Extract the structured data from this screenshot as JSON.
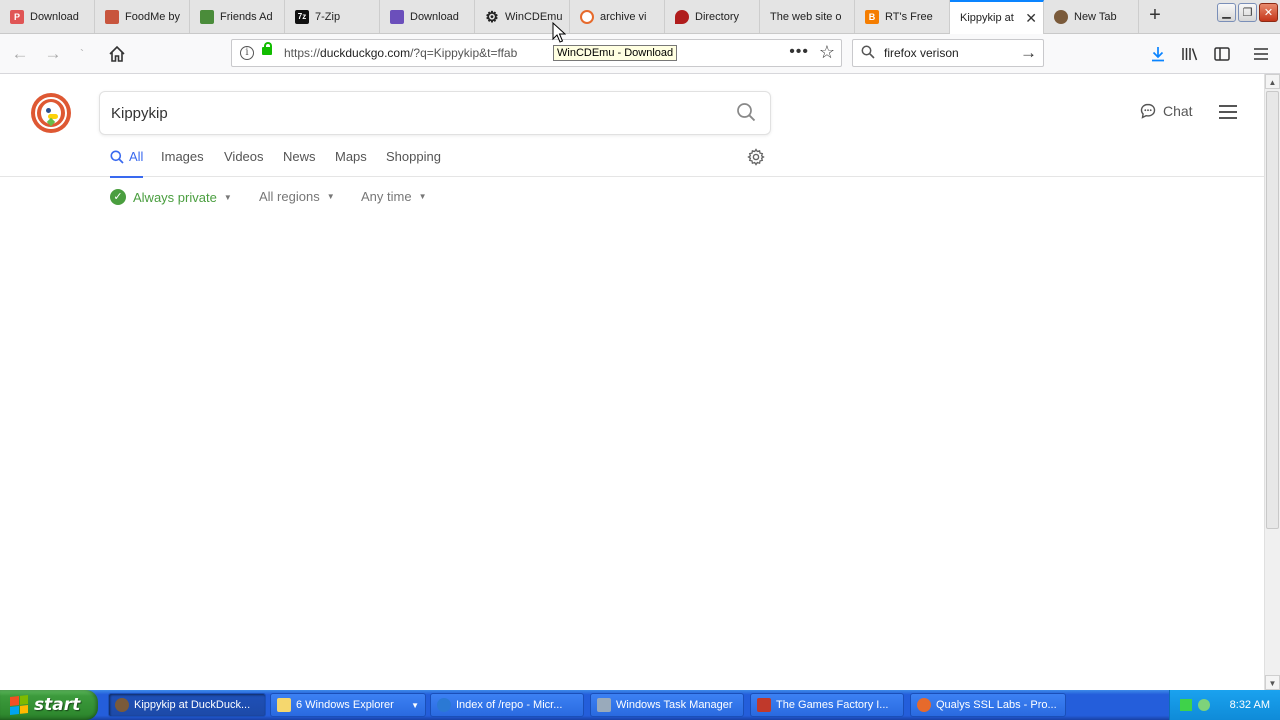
{
  "browser": {
    "tabs": [
      {
        "label": "Download",
        "icon": "pdf-icon",
        "color": "#e05555"
      },
      {
        "label": "FoodMe by",
        "icon": "food-icon",
        "color": "#c8553d"
      },
      {
        "label": "Friends Ad",
        "icon": "friends-icon",
        "color": "#4a8c3a"
      },
      {
        "label": "7-Zip",
        "icon": "7zip-icon",
        "color": "#111111"
      },
      {
        "label": "Download",
        "icon": "download-site-icon",
        "color": "#6b4fbb"
      },
      {
        "label": "WinCDEmu",
        "icon": "gear-icon",
        "color": "#222222"
      },
      {
        "label": "archive vi",
        "icon": "archive-icon",
        "color": "#e66a2c"
      },
      {
        "label": "Directory",
        "icon": "directory-icon",
        "color": "#b01c1c"
      },
      {
        "label": "The web site o",
        "icon": "",
        "color": ""
      },
      {
        "label": "RT's Free",
        "icon": "blogger-icon",
        "color": "#f57d00"
      },
      {
        "label": "Kippykip at",
        "icon": "",
        "color": "",
        "active": true
      },
      {
        "label": "New Tab",
        "icon": "firefox-icon",
        "color": "#7a5a3a"
      }
    ],
    "url_prefix": "https://",
    "url_host": "duckduckgo.com",
    "url_rest": "/?q=Kippykip&t=ffab",
    "tooltip": "WinCDEmu - Download",
    "search_value": "firefox verison"
  },
  "page": {
    "query": "Kippykip",
    "chat_label": "Chat",
    "tabs": [
      "All",
      "Images",
      "Videos",
      "News",
      "Maps",
      "Shopping"
    ],
    "filters": {
      "privacy": "Always private",
      "region": "All regions",
      "time": "Any time"
    },
    "accent": "#3969ef",
    "brand": "#de5833"
  },
  "taskbar": {
    "start_label": "start",
    "tasks": [
      {
        "label": "Kippykip at DuckDuck...",
        "active": true
      },
      {
        "label": "6 Windows Explorer"
      },
      {
        "label": "Index of /repo - Micr..."
      },
      {
        "label": "Windows Task Manager"
      },
      {
        "label": "The Games Factory I..."
      },
      {
        "label": "Qualys SSL Labs - Pro..."
      }
    ],
    "time": "8:32 AM"
  }
}
